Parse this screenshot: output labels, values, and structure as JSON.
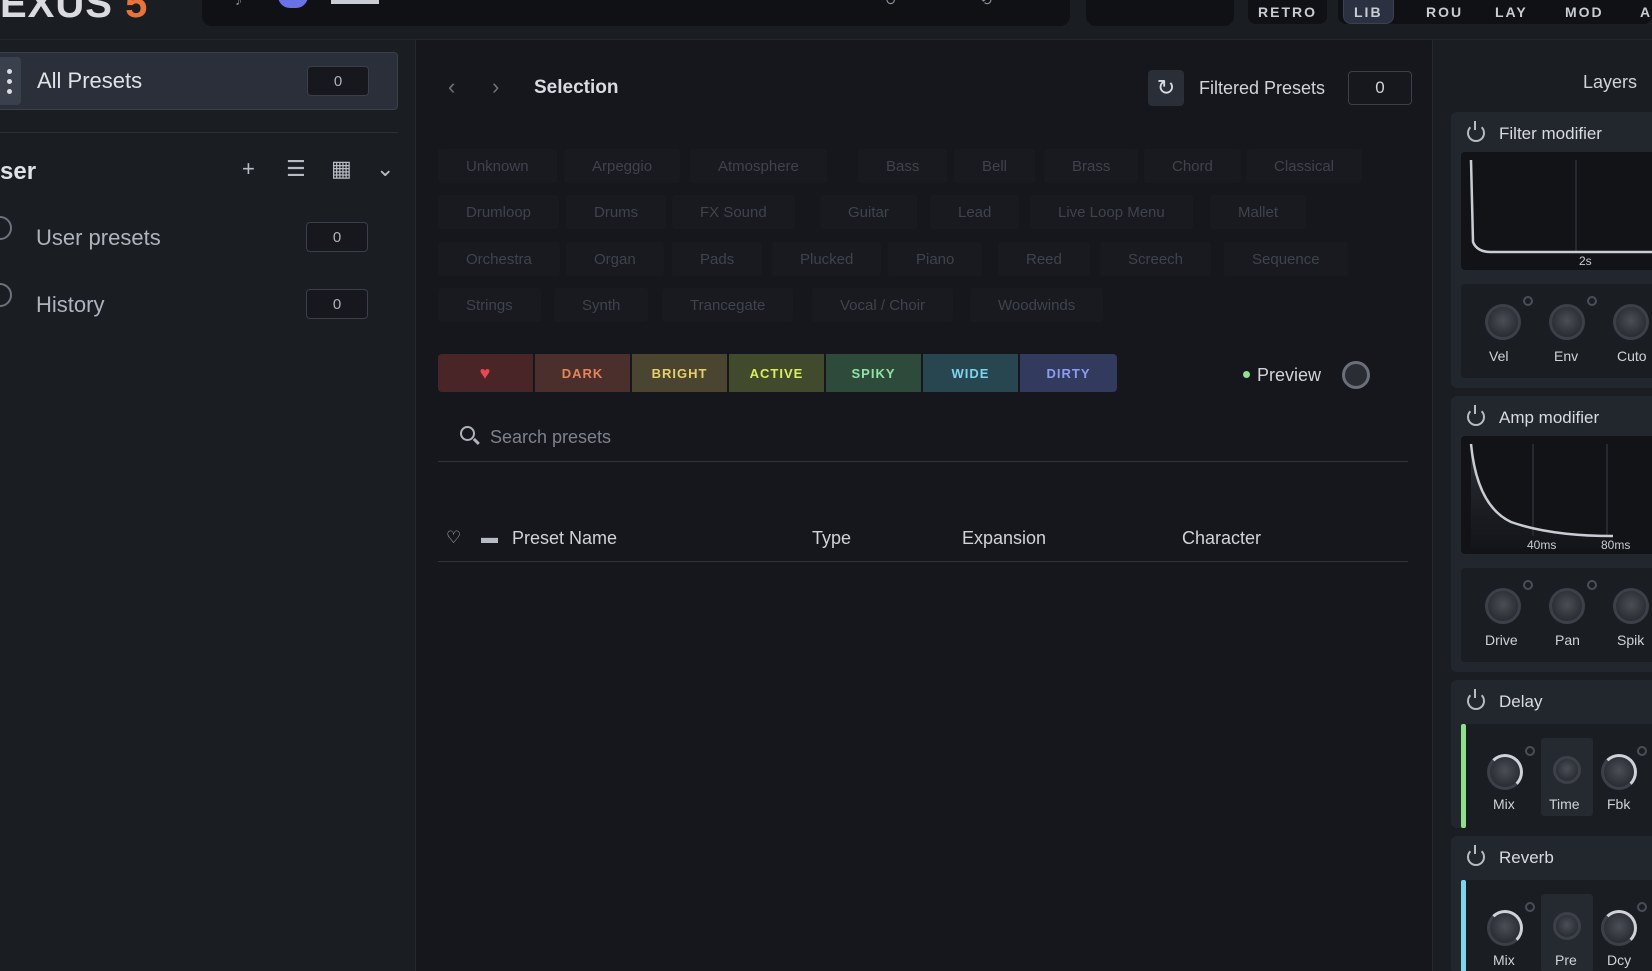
{
  "top": {
    "logo_main": "EXUS",
    "logo_version": "5",
    "modes": [
      "RETRO",
      "LIB",
      "ROU",
      "LAY",
      "MOD",
      "A"
    ]
  },
  "sidebar": {
    "all_presets": {
      "label": "All Presets",
      "count": "0"
    },
    "section_title": "ser",
    "items": [
      {
        "label": "User presets",
        "count": "0"
      },
      {
        "label": "History",
        "count": "0"
      }
    ]
  },
  "selection": {
    "title": "Selection",
    "filtered_label": "Filtered Presets",
    "filtered_count": "0"
  },
  "tags": {
    "row1": [
      "Unknown",
      "Arpeggio",
      "Atmosphere",
      "Bass",
      "Bell",
      "Brass",
      "Chord",
      "Classical"
    ],
    "row2": [
      "Drumloop",
      "Drums",
      "FX Sound",
      "Guitar",
      "Lead",
      "Live Loop Menu",
      "Mallet"
    ],
    "row3": [
      "Orchestra",
      "Organ",
      "Pads",
      "Plucked",
      "Piano",
      "Reed",
      "Screech",
      "Sequence"
    ],
    "row4": [
      "Strings",
      "Synth",
      "Trancegate",
      "Vocal / Choir",
      "Woodwinds"
    ]
  },
  "characters": [
    {
      "label": "DARK",
      "bg": "#4a2f2c",
      "fg": "#e8845a"
    },
    {
      "label": "BRIGHT",
      "bg": "#4a4530",
      "fg": "#e8cf6a"
    },
    {
      "label": "ACTIVE",
      "bg": "#414a2c",
      "fg": "#d8ef5e"
    },
    {
      "label": "SPIKY",
      "bg": "#2e4a3a",
      "fg": "#8fe3a6"
    },
    {
      "label": "WIDE",
      "bg": "#284650",
      "fg": "#7fd3ef"
    },
    {
      "label": "DIRTY",
      "bg": "#323b5e",
      "fg": "#8e9cf0"
    }
  ],
  "favorite_color": "#e8484e",
  "favorite_bg": "#4a2528",
  "preview": {
    "label": "Preview",
    "dot_color": "#8fe08f"
  },
  "search": {
    "placeholder": "Search presets",
    "value": ""
  },
  "table": {
    "columns": [
      "Preset Name",
      "Type",
      "Expansion",
      "Character"
    ]
  },
  "rpanel": {
    "tab": "Layers",
    "filter_mod": {
      "title": "Filter modifier",
      "time_label": "2s",
      "knobs": [
        "Vel",
        "Env",
        "Cuto"
      ]
    },
    "amp_mod": {
      "title": "Amp modifier",
      "time_labels": [
        "40ms",
        "80ms"
      ],
      "knobs": [
        "Drive",
        "Pan",
        "Spik"
      ]
    },
    "delay": {
      "title": "Delay",
      "knobs": [
        "Mix",
        "Time",
        "Fbk"
      ],
      "accent": "#8ee08a"
    },
    "reverb": {
      "title": "Reverb",
      "knobs": [
        "Mix",
        "Pre",
        "Dcy"
      ],
      "accent": "#7fd3ef"
    }
  }
}
